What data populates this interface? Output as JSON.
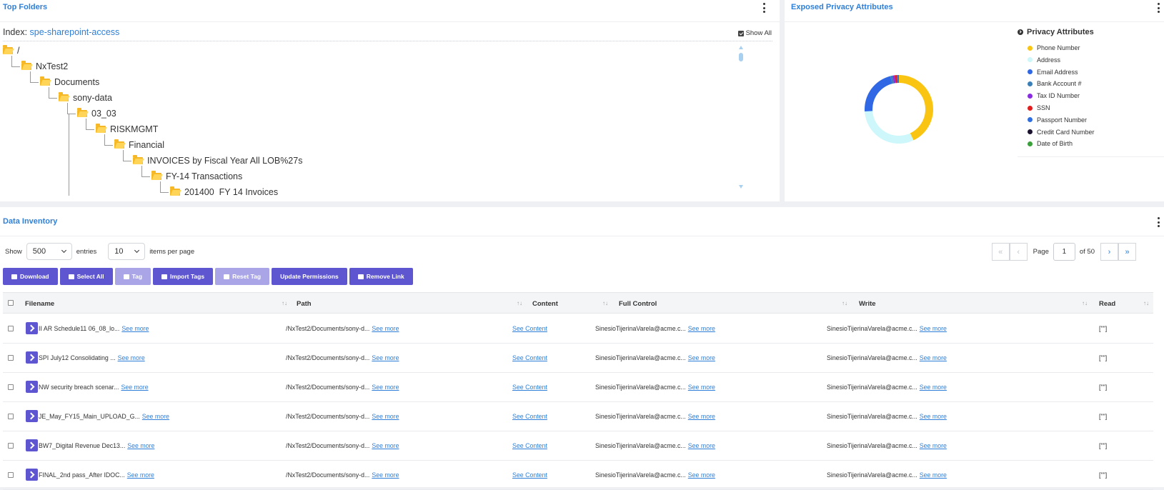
{
  "top_folders": {
    "title": "Top Folders",
    "index_label": "Index:",
    "index_value": "spe-sharepoint-access",
    "show_all_label": "Show All",
    "tree": [
      {
        "label": "/",
        "depth": 0
      },
      {
        "label": "NxTest2",
        "depth": 1
      },
      {
        "label": "Documents",
        "depth": 2
      },
      {
        "label": "sony-data",
        "depth": 3
      },
      {
        "label": "03_03",
        "depth": 4
      },
      {
        "label": "RISKMGMT",
        "depth": 5
      },
      {
        "label": "Financial",
        "depth": 6
      },
      {
        "label": "INVOICES by Fiscal Year All LOB%27s",
        "depth": 7
      },
      {
        "label": "FY-14 Transactions",
        "depth": 8
      },
      {
        "label": "201400_FY 14 Invoices",
        "depth": 9
      }
    ]
  },
  "privacy": {
    "title": "Exposed Privacy Attributes",
    "legend_title": "Privacy Attributes",
    "legend": [
      {
        "label": "Phone Number",
        "color": "#f9c512"
      },
      {
        "label": "Address",
        "color": "#cdf7fa"
      },
      {
        "label": "Email Address",
        "color": "#2f67e4"
      },
      {
        "label": "Bank Account #",
        "color": "#3a7fb8"
      },
      {
        "label": "Tax ID Number",
        "color": "#8a2be2"
      },
      {
        "label": "SSN",
        "color": "#e31d1d"
      },
      {
        "label": "Passport Number",
        "color": "#2f6de0"
      },
      {
        "label": "Credit Card Number",
        "color": "#1b1230"
      },
      {
        "label": "Date of Birth",
        "color": "#3aa03a"
      }
    ],
    "chart_data": {
      "type": "pie",
      "categories": [
        "Phone Number",
        "Address",
        "Email Address",
        "Bank Account #",
        "Tax ID Number",
        "SSN",
        "Passport Number",
        "Credit Card Number",
        "Date of Birth"
      ],
      "values": [
        43,
        31,
        22,
        1,
        1,
        1,
        1,
        0,
        0
      ],
      "donut": true
    }
  },
  "inventory": {
    "title": "Data Inventory",
    "show_label": "Show",
    "entries_value": "500",
    "entries_label": "entries",
    "per_page_value": "10",
    "per_page_label": "items per page",
    "pager": {
      "first": "«",
      "prev": "‹",
      "page_label": "Page",
      "page_value": "1",
      "of_label": "of 50",
      "next": "›",
      "last": "»"
    },
    "buttons": [
      "Download",
      "Select All",
      "Tag",
      "Import Tags",
      "Reset Tag",
      "Update Permissions",
      "Remove Link"
    ],
    "columns": [
      "Filename",
      "Path",
      "Content",
      "Full Control",
      "Write",
      "Read"
    ],
    "see_more": "See more",
    "see_content": "See Content",
    "rows": [
      {
        "filename": "II AR Schedule11 06_08_lo...",
        "path": "/NxTest2/Documents/sony-d...",
        "full_control": "SinesioTijerinaVarela@acme.c...",
        "write": "SinesioTijerinaVarela@acme.c...",
        "read": "[\"\"]"
      },
      {
        "filename": "SPI July12 Consolidating ...",
        "path": "/NxTest2/Documents/sony-d...",
        "full_control": "SinesioTijerinaVarela@acme.c...",
        "write": "SinesioTijerinaVarela@acme.c...",
        "read": "[\"\"]"
      },
      {
        "filename": "NW security breach scenar...",
        "path": "/NxTest2/Documents/sony-d...",
        "full_control": "SinesioTijerinaVarela@acme.c...",
        "write": "SinesioTijerinaVarela@acme.c...",
        "read": "[\"\"]"
      },
      {
        "filename": "JE_May_FY15_Main_UPLOAD_G...",
        "path": "/NxTest2/Documents/sony-d...",
        "full_control": "SinesioTijerinaVarela@acme.c...",
        "write": "SinesioTijerinaVarela@acme.c...",
        "read": "[\"\"]"
      },
      {
        "filename": "BW7_Digital Revenue Dec13...",
        "path": "/NxTest2/Documents/sony-d...",
        "full_control": "SinesioTijerinaVarela@acme.c...",
        "write": "SinesioTijerinaVarela@acme.c...",
        "read": "[\"\"]"
      },
      {
        "filename": "FINAL_2nd pass_After IDOC...",
        "path": "/NxTest2/Documents/sony-d...",
        "full_control": "SinesioTijerinaVarela@acme.c...",
        "write": "SinesioTijerinaVarela@acme.c...",
        "read": "[\"\"]"
      }
    ]
  }
}
